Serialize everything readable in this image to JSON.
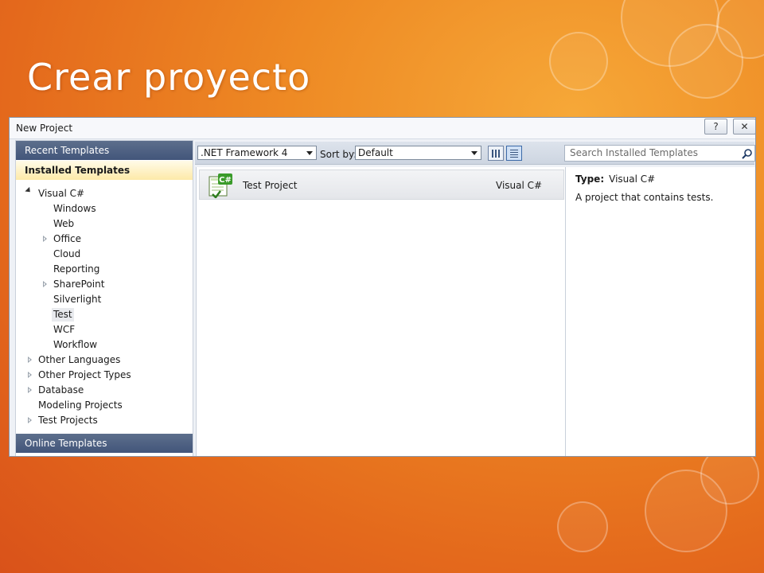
{
  "slide": {
    "title": "Crear proyecto"
  },
  "dialog": {
    "title": "New Project",
    "help_label": "?",
    "close_label": "✕"
  },
  "left_panel": {
    "recent_templates": "Recent Templates",
    "installed_templates": "Installed Templates",
    "online_templates": "Online Templates",
    "tree": [
      {
        "label": "Visual C#",
        "expander": "expanded"
      },
      {
        "label": "Windows"
      },
      {
        "label": "Web"
      },
      {
        "label": "Office",
        "expander": "collapsed"
      },
      {
        "label": "Cloud"
      },
      {
        "label": "Reporting"
      },
      {
        "label": "SharePoint",
        "expander": "collapsed"
      },
      {
        "label": "Silverlight"
      },
      {
        "label": "Test",
        "selected": true
      },
      {
        "label": "WCF"
      },
      {
        "label": "Workflow"
      },
      {
        "label": "Other Languages",
        "expander": "collapsed"
      },
      {
        "label": "Other Project Types",
        "expander": "collapsed"
      },
      {
        "label": "Database",
        "expander": "collapsed"
      },
      {
        "label": "Modeling Projects"
      },
      {
        "label": "Test Projects",
        "expander": "collapsed"
      }
    ]
  },
  "toolbar": {
    "framework_value": ".NET Framework 4",
    "sort_label": "Sort by:",
    "sort_value": "Default",
    "search_placeholder": "Search Installed Templates"
  },
  "templates": [
    {
      "name": "Test Project",
      "language": "Visual C#",
      "icon": "csharp-test-project-icon"
    }
  ],
  "details": {
    "type_label": "Type:",
    "type_value": "Visual C#",
    "description": "A project that contains tests."
  },
  "colors": {
    "slide_background": "#ee8a24",
    "section_header": "#4a5d80",
    "selected_section": "#fdecb0",
    "icon_green": "#3a9b2a"
  }
}
